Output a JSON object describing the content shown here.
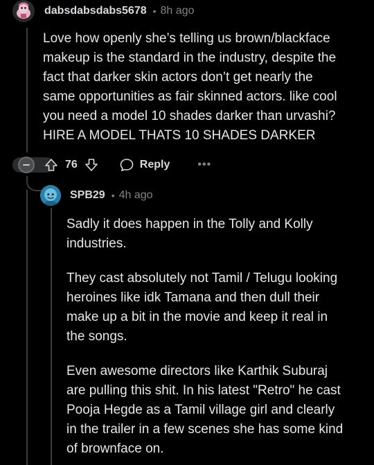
{
  "comment": {
    "username": "dabsdabsdabs5678",
    "separator": "•",
    "time": "8h ago",
    "avatar_icon": "snoo-avatar-pink",
    "body_lines": [
      "Love how openly she’s telling us brown/blackface",
      "makeup is the standard in the industry, despite the",
      "fact that darker skin actors don’t get nearly the",
      "same opportunities as fair skinned actors. like cool",
      "you need a model 10 shades darker than urvashi?",
      "HIRE A MODEL THATS 10 SHADES DARKER"
    ],
    "vote_count": "76",
    "reply_label": "Reply",
    "more_label": "•••"
  },
  "reply": {
    "username": "SPB29",
    "separator": "•",
    "time": "4h ago",
    "avatar_icon": "snoo-avatar-blue",
    "paragraphs": [
      {
        "lines": [
          "Sadly it does happen in the Tolly and Kolly",
          "industries."
        ]
      },
      {
        "lines": [
          "They cast absolutely not Tamil / Telugu looking",
          "heroines like idk Tamana and then dull their",
          "make up a bit in the movie and keep it real in",
          "the songs."
        ]
      },
      {
        "lines": [
          "Even awesome directors like Karthik Suburaj",
          "are pulling this shit. In his latest \"Retro\" he cast",
          "Pooja Hegde as a Tamil village girl and clearly",
          "in the trailer in a few scenes she has some kind",
          "of brownface on."
        ]
      }
    ]
  },
  "colors": {
    "background": "#000000",
    "text": "#e6e7e8",
    "meta": "#818384",
    "thread_line": "#3a3c3e",
    "reply_avatar": "#2d7fa8"
  }
}
